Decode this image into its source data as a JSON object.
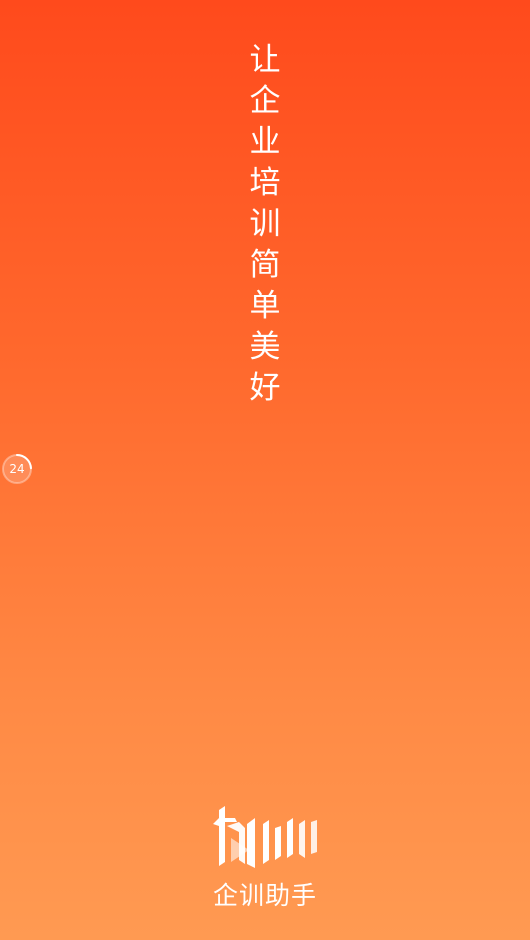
{
  "splash": {
    "slogan_chars": [
      "让",
      "企",
      "业",
      "培",
      "训",
      "简",
      "单",
      "美",
      "好"
    ],
    "countdown": "24",
    "countdown_fraction": 0.24,
    "app_name": "企训助手",
    "logo_icon": "qixun-logo-icon"
  },
  "colors": {
    "gradient_top": "#ff4a1c",
    "gradient_bottom": "#ff9a52",
    "text": "#ffffff"
  }
}
